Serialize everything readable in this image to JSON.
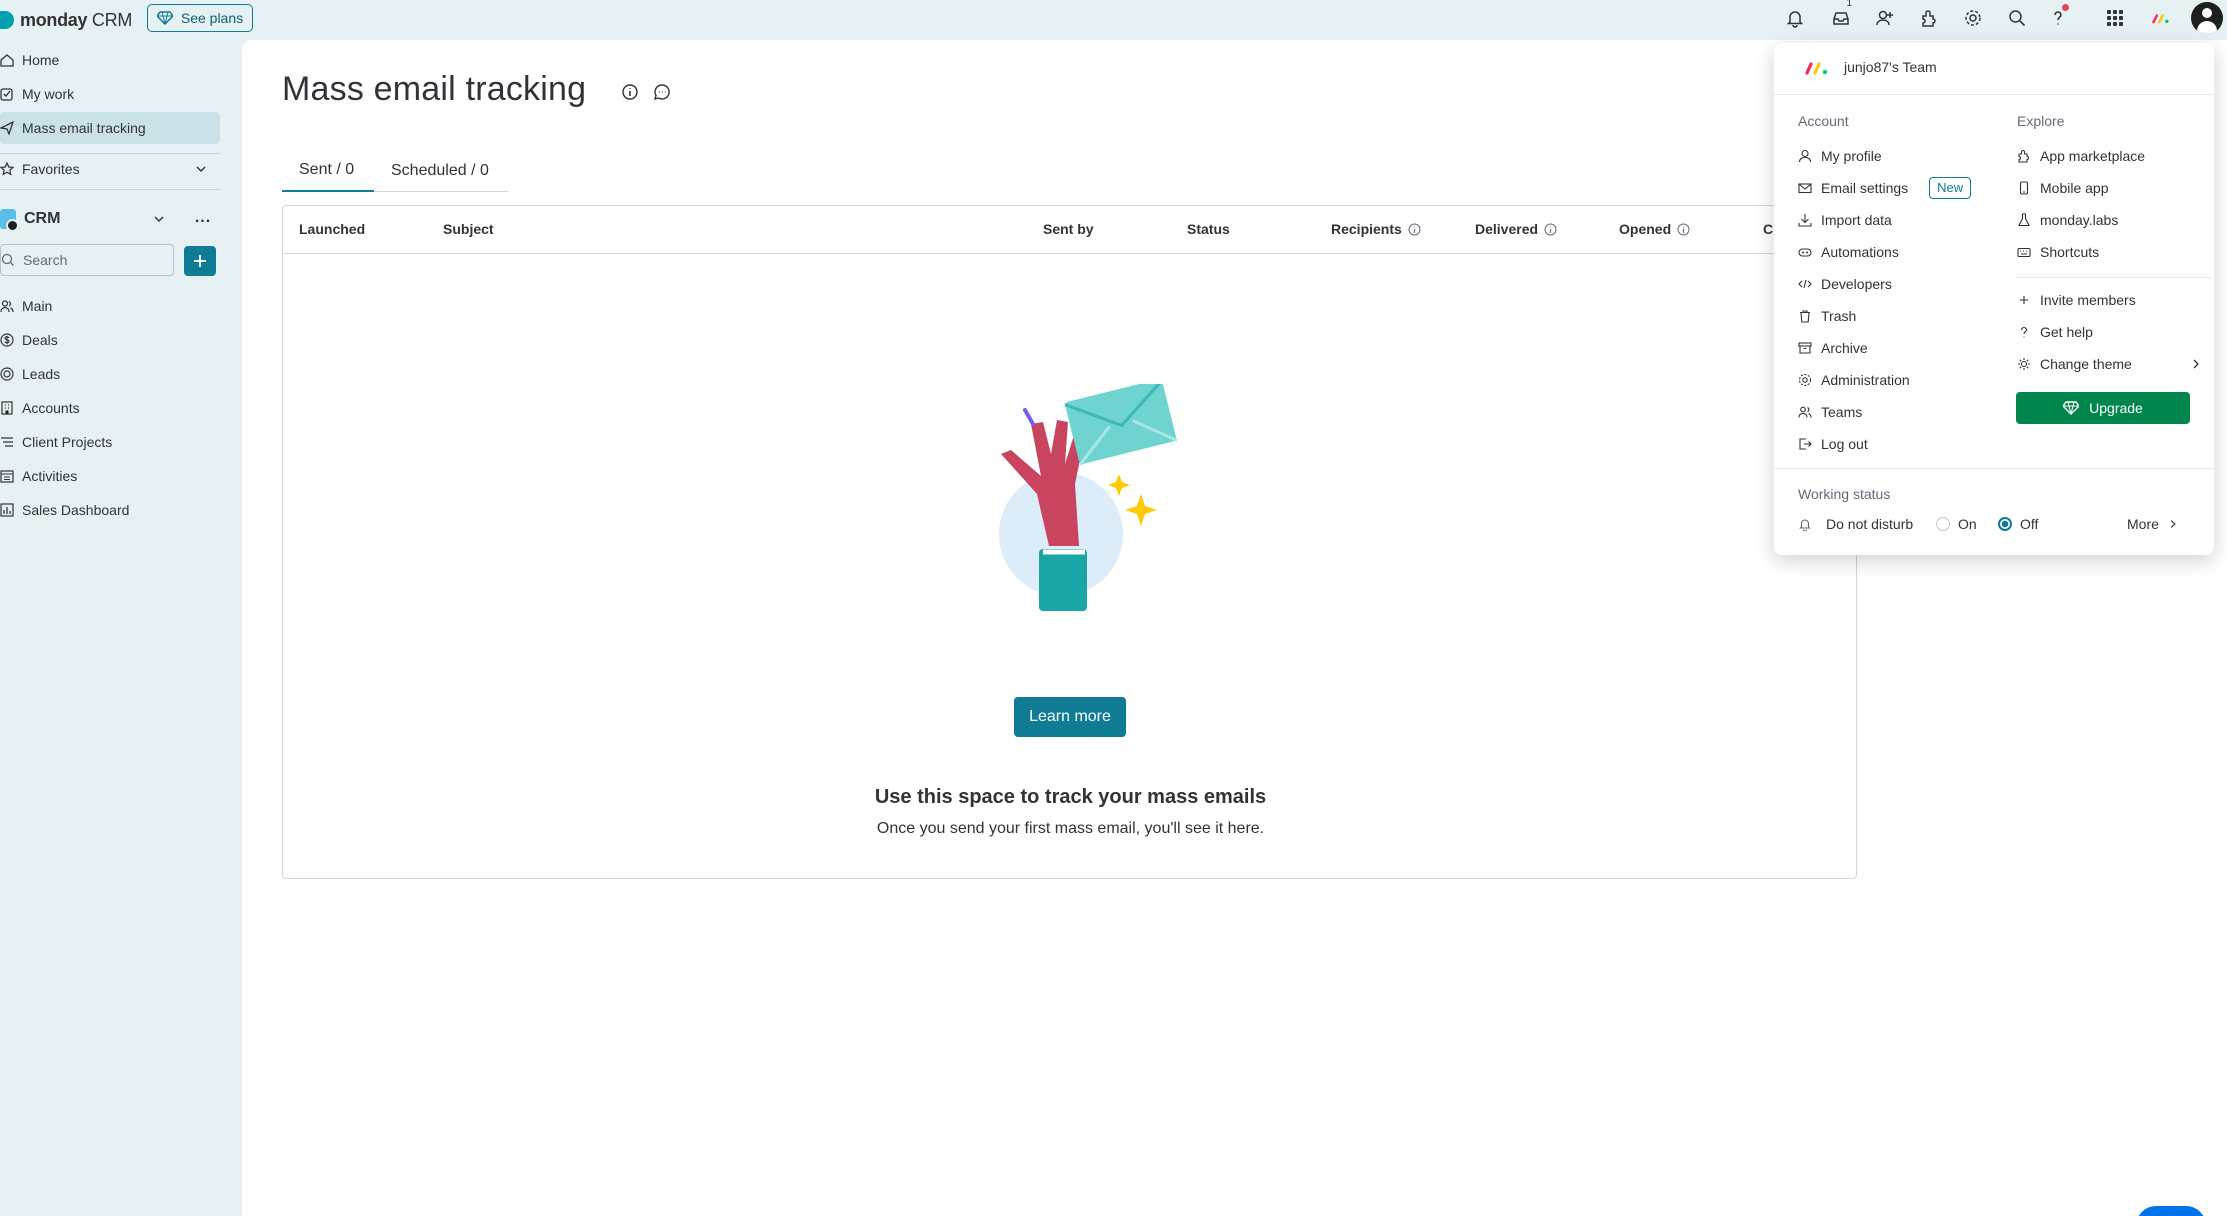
{
  "app": {
    "brand": "monday",
    "brand_sub": "CRM",
    "see_plans": "See plans"
  },
  "topbar": {
    "inbox_badge": "1",
    "icons": [
      "bell-icon",
      "inbox-icon",
      "invite-icon",
      "apps-icon",
      "gear-icon",
      "search-icon",
      "help-icon",
      "grid-icon",
      "monday-icon",
      "avatar"
    ]
  },
  "sidebar": {
    "top_items": [
      {
        "label": "Home",
        "icon": "home-icon"
      },
      {
        "label": "My work",
        "icon": "checkbox-icon"
      },
      {
        "label": "Mass email tracking",
        "icon": "send-icon",
        "active": true
      }
    ],
    "favorites": "Favorites",
    "workspace": "CRM",
    "workspace_more": "...",
    "search_placeholder": "Search",
    "boards": [
      {
        "label": "Main",
        "icon": "people-icon"
      },
      {
        "label": "Deals",
        "icon": "dollar-icon"
      },
      {
        "label": "Leads",
        "icon": "target-icon"
      },
      {
        "label": "Accounts",
        "icon": "building-icon"
      },
      {
        "label": "Client Projects",
        "icon": "list-icon"
      },
      {
        "label": "Activities",
        "icon": "calendar-list-icon"
      },
      {
        "label": "Sales Dashboard",
        "icon": "dashboard-icon"
      }
    ]
  },
  "main": {
    "title": "Mass email tracking",
    "tabs": [
      {
        "label": "Sent / 0",
        "active": true
      },
      {
        "label": "Scheduled / 0",
        "active": false
      }
    ],
    "columns": [
      "Launched",
      "Subject",
      "Sent by",
      "Status",
      "Recipients",
      "Delivered",
      "Opened",
      "Click"
    ],
    "empty_title": "Use this space to track your mass emails",
    "empty_subtitle": "Once you send your first mass email, you'll see it here.",
    "learn_more": "Learn more"
  },
  "dropdown": {
    "team": "junjo87's Team",
    "account_heading": "Account",
    "explore_heading": "Explore",
    "account_items": [
      {
        "label": "My profile",
        "icon": "user-icon"
      },
      {
        "label": "Email settings",
        "icon": "mail-icon",
        "tag": "New"
      },
      {
        "label": "Import data",
        "icon": "download-icon"
      },
      {
        "label": "Automations",
        "icon": "robot-icon"
      },
      {
        "label": "Developers",
        "icon": "code-icon"
      },
      {
        "label": "Trash",
        "icon": "trash-icon"
      },
      {
        "label": "Archive",
        "icon": "archive-icon"
      },
      {
        "label": "Administration",
        "icon": "gear-icon"
      },
      {
        "label": "Teams",
        "icon": "team-icon"
      },
      {
        "label": "Log out",
        "icon": "logout-icon"
      }
    ],
    "explore_items": [
      {
        "label": "App marketplace",
        "icon": "puzzle-icon"
      },
      {
        "label": "Mobile app",
        "icon": "phone-icon"
      },
      {
        "label": "monday.labs",
        "icon": "flask-icon"
      },
      {
        "label": "Shortcuts",
        "icon": "keyboard-icon"
      }
    ],
    "extra_items": [
      {
        "label": "Invite members",
        "icon": "plus-icon"
      },
      {
        "label": "Get help",
        "icon": "question-icon"
      },
      {
        "label": "Change theme",
        "icon": "sun-icon"
      }
    ],
    "upgrade": "Upgrade",
    "working_status": "Working status",
    "do_not_disturb": "Do not disturb",
    "on": "On",
    "off": "Off",
    "off_selected": true,
    "more": "More"
  },
  "colors": {
    "accent": "#0f7b95",
    "upgrade": "#00854d",
    "background": "#e6f1f4"
  }
}
